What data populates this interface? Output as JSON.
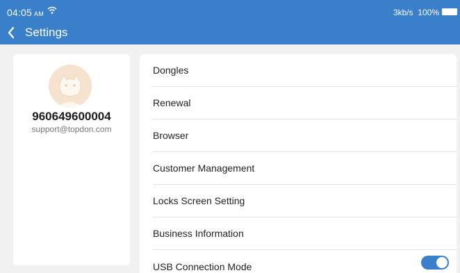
{
  "status_bar": {
    "time": "04:05",
    "ampm": "AM",
    "speed": "3kb/s",
    "battery": "100%"
  },
  "header": {
    "title": "Settings"
  },
  "profile": {
    "id": "960649600004",
    "email": "support@topdon.com"
  },
  "menu": {
    "items": [
      {
        "label": "Dongles"
      },
      {
        "label": "Renewal"
      },
      {
        "label": "Browser"
      },
      {
        "label": "Customer Management"
      },
      {
        "label": "Locks Screen Setting"
      },
      {
        "label": "Business Information"
      },
      {
        "label": "USB Connection Mode"
      }
    ]
  },
  "colors": {
    "header": "#3a7fc9",
    "background": "#f1f1f1",
    "toggle_on": "#3a7fc9"
  },
  "icons": {
    "back": "back-arrow-icon",
    "wifi": "wifi-icon",
    "battery": "battery-icon"
  }
}
